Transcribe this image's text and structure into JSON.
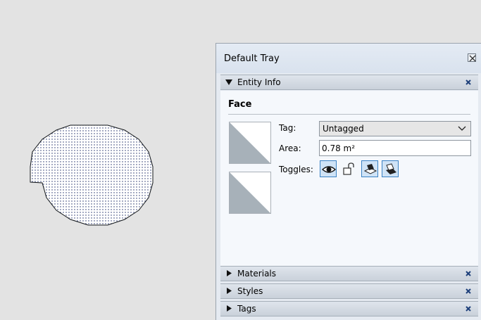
{
  "tray": {
    "title": "Default Tray"
  },
  "entity_info": {
    "header": "Entity Info",
    "entity_type": "Face",
    "tag_label": "Tag:",
    "tag_value": "Untagged",
    "area_label": "Area:",
    "area_value": "0.78 m²",
    "toggles_label": "Toggles:",
    "toggles": [
      {
        "name": "visibility",
        "icon": "eye-icon",
        "active": true
      },
      {
        "name": "lock",
        "icon": "unlock-icon",
        "active": false
      },
      {
        "name": "receive-shadows",
        "icon": "receive-shadows-icon",
        "active": true
      },
      {
        "name": "cast-shadows",
        "icon": "cast-shadows-icon",
        "active": true
      }
    ]
  },
  "collapsed_panels": [
    {
      "label": "Materials"
    },
    {
      "label": "Styles"
    },
    {
      "label": "Tags"
    }
  ],
  "colors": {
    "swatch_gray": "#a7b1b9",
    "toggle_active_border": "#3b82c4",
    "toggle_active_fill": "#cfe3f6",
    "face_dots": "#1b2a66"
  }
}
